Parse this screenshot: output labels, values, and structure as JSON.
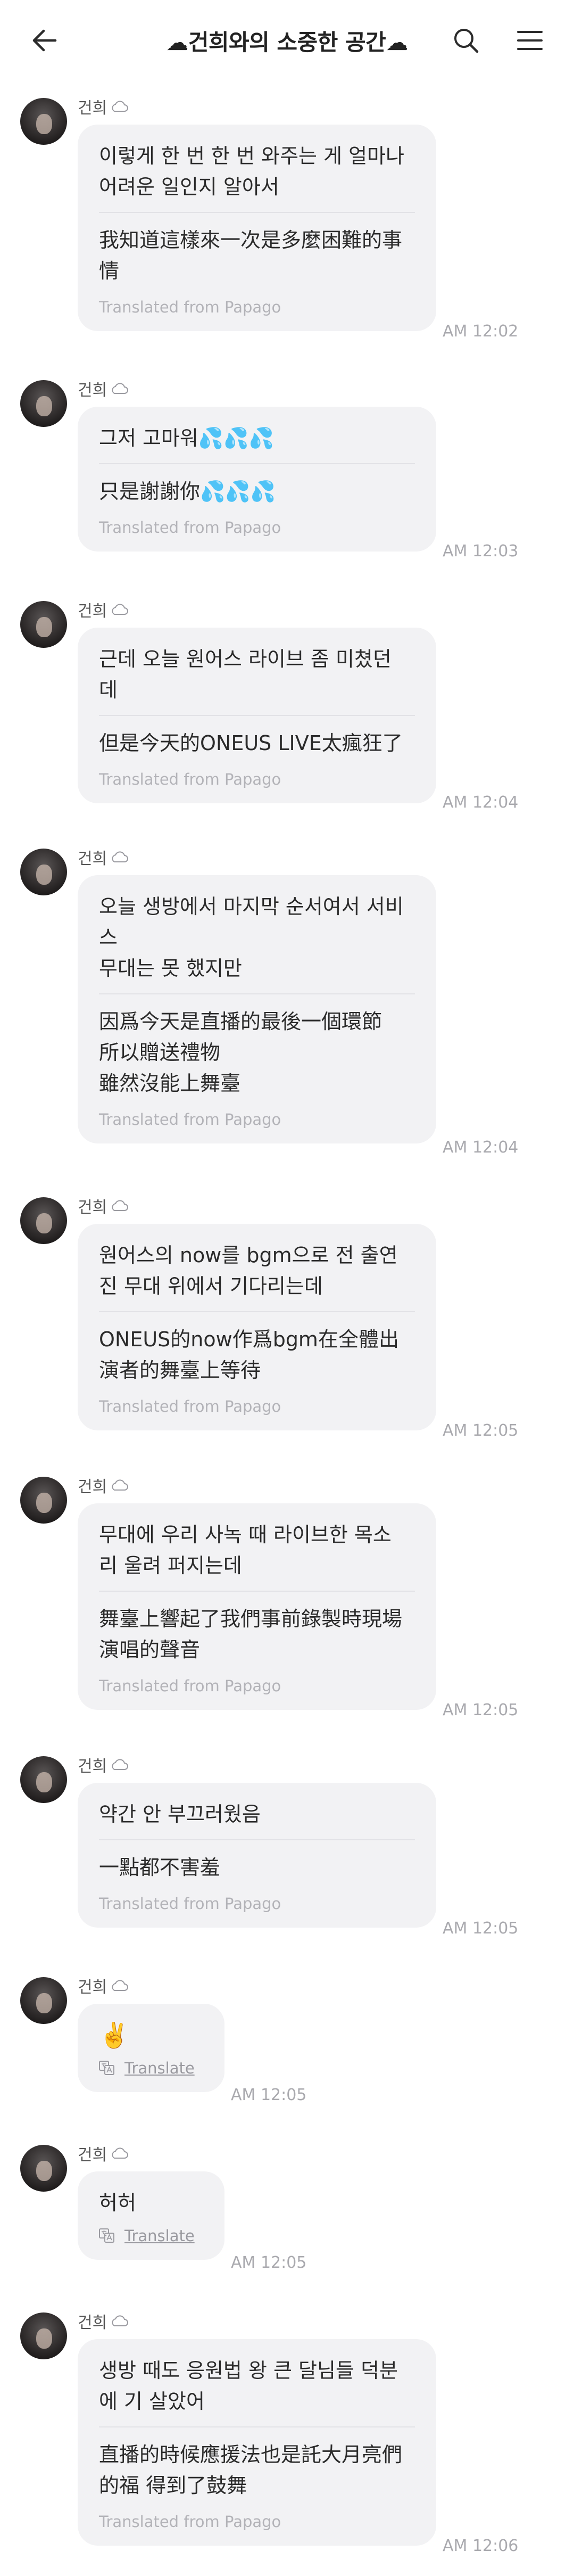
{
  "header": {
    "title": "☁건희와의 소중한 공간☁"
  },
  "messages": [
    {
      "sender": "건희",
      "original": "이렇게 한 번 한 번 와주는 게 얼마나\n어려운 일인지 알아서",
      "translation": "我知道這樣來一次是多麼困難的事\n情",
      "credit": "Translated from Papago",
      "time": "AM 12:02"
    },
    {
      "sender": "건희",
      "original": "그저 고마워💦💦💦",
      "translation": "只是謝謝你💦💦💦",
      "credit": "Translated from Papago",
      "time": "AM 12:03"
    },
    {
      "sender": "건희",
      "original": "근데 오늘 원어스 라이브 좀 미쳤던\n데",
      "translation": "但是今天的ONEUS LIVE太瘋狂了",
      "credit": "Translated from Papago",
      "time": "AM 12:04"
    },
    {
      "sender": "건희",
      "original": "오늘 생방에서 마지막 순서여서 서비\n스\n무대는 못 했지만",
      "translation": "因爲今天是直播的最後一個環節\n所以贈送禮物\n雖然沒能上舞臺",
      "credit": "Translated from Papago",
      "time": "AM 12:04"
    },
    {
      "sender": "건희",
      "original": "원어스의 now를 bgm으로 전 출연\n진 무대 위에서 기다리는데",
      "translation": "ONEUS的now作爲bgm在全體出\n演者的舞臺上等待",
      "credit": "Translated from Papago",
      "time": "AM 12:05"
    },
    {
      "sender": "건희",
      "original": "무대에 우리 사녹 때 라이브한 목소\n리 울려 퍼지는데",
      "translation": "舞臺上響起了我們事前錄製時現場\n演唱的聲音",
      "credit": "Translated from Papago",
      "time": "AM 12:05"
    },
    {
      "sender": "건희",
      "original": "약간 안 부끄러웠음",
      "translation": "一點都不害羞",
      "credit": "Translated from Papago",
      "time": "AM 12:05"
    },
    {
      "sender": "건희",
      "original": "✌️",
      "translate_label": "Translate",
      "time": "AM 12:05"
    },
    {
      "sender": "건희",
      "original": "허허",
      "translate_label": "Translate",
      "time": "AM 12:05"
    },
    {
      "sender": "건희",
      "original": "생방 때도 응원법 왕 큰 달님들 덕분\n에 기 살았어",
      "translation": "直播的時候應援法也是託大月亮們\n的福 得到了鼓舞",
      "credit": "Translated from Papago",
      "time": "AM 12:06"
    }
  ]
}
